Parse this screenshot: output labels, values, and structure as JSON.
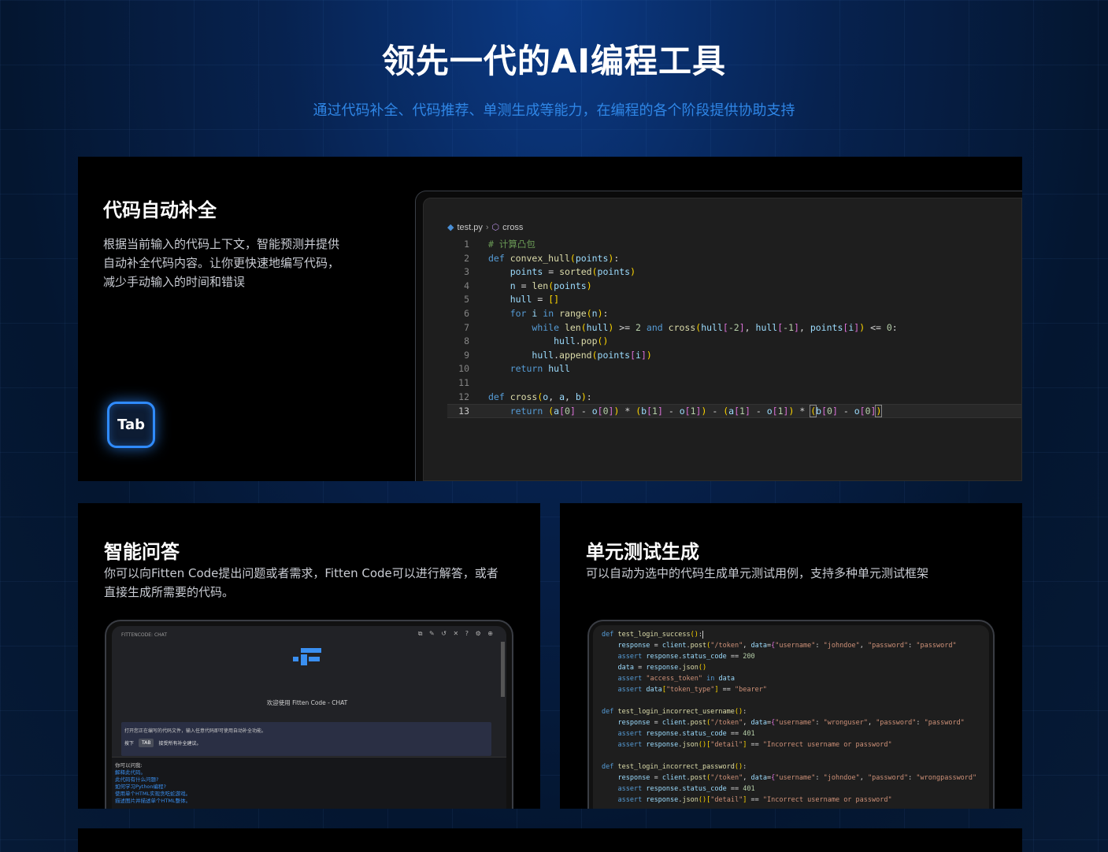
{
  "hero": {
    "title": "领先一代的AI编程工具",
    "subtitle": "通过代码补全、代码推荐、单测生成等能力，在编程的各个阶段提供协助支持"
  },
  "autocomplete": {
    "title": "代码自动补全",
    "desc_lines": [
      "根据当前输入的代码上下文，智能预测并提供",
      "自动补全代码内容。让你更快速地编写代码，",
      "减少手动输入的时间和错误"
    ],
    "tab_key": "Tab",
    "editor": {
      "file": "test.py",
      "symbol": "cross",
      "line_numbers": [
        "1",
        "2",
        "3",
        "4",
        "5",
        "6",
        "7",
        "8",
        "9",
        "10",
        "11",
        "12",
        "13"
      ]
    }
  },
  "chat_card": {
    "title": "智能问答",
    "desc_lines": [
      "你可以向Fitten Code提出问题或者需求，Fitten Code可以进行解答，或者",
      "直接生成所需要的代码。"
    ],
    "panel_title": "FITTENCODE: CHAT",
    "tools": "⧉ ✎ ↺ ✕ ? ⚙ ⊕",
    "welcome": "欢迎使用 Fitten Code - CHAT",
    "tip": "打开您正在编写的代码文件，输入任意代码即可使用自动补全功能。",
    "tip_press": "按下",
    "tip_key": "TAB",
    "tip_accept": "接受所有补全建议。",
    "questions_title": "你可以问我:",
    "questions": [
      "解释此代码。",
      "此代码有什么问题?",
      "如何学习Python编程?",
      "使用单个HTML实现贪吃蛇游戏。",
      "描述图片并描述单个HTML整体。"
    ]
  },
  "test_card": {
    "title": "单元测试生成",
    "desc": "可以自动为选中的代码生成单元测试用例，支持多种单元测试框架"
  },
  "colors": {
    "accent": "#2f86e6",
    "card_bg": "#000000",
    "editor_bg": "#1e1e1e"
  }
}
